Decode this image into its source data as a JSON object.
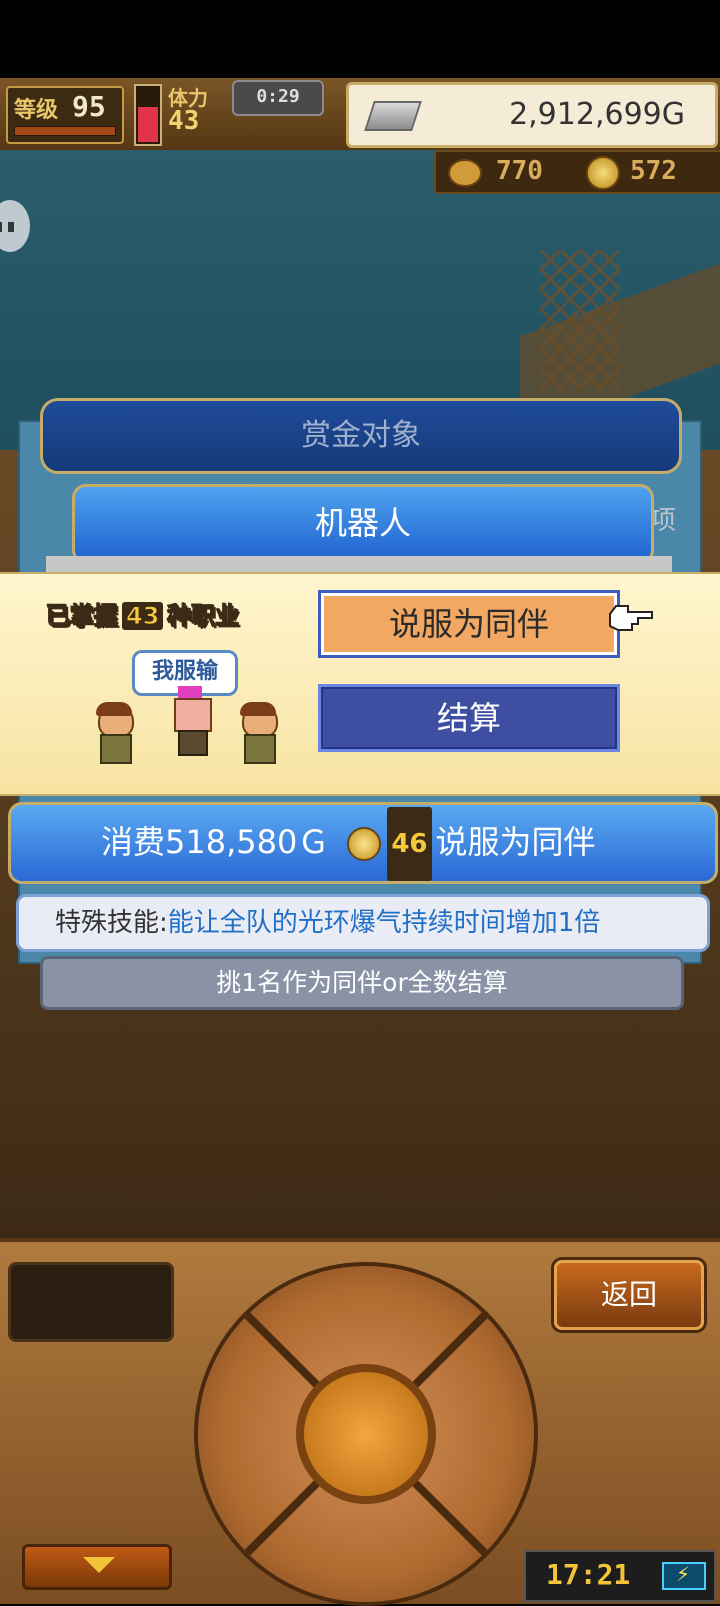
{
  "hud": {
    "level_label": "等级",
    "level_value": "95",
    "stamina_label": "体力",
    "stamina_value": "43",
    "timer": "0:29",
    "money": "2,912,699G",
    "medals": "770",
    "coins": "572"
  },
  "dialog": {
    "title": "赏金对象",
    "target_name": "机器人",
    "side_label": "项",
    "mastered_prefix": "已掌握",
    "mastered_count": "43",
    "mastered_suffix": "种职业",
    "speech": "我服输",
    "persuade_button": "说服为同伴",
    "settle_button": "结算",
    "cost_prefix": "消费518,580Ｇ",
    "cost_coins": "46",
    "cost_suffix": "说服为同伴",
    "skill_label": "特殊技能:",
    "skill_desc": "能让全队的光环爆气持续时间增加1倍",
    "hint": "挑1名作为同伴or全数结算"
  },
  "controls": {
    "back_button": "返回",
    "clock": "17:21",
    "down_icon": "triangle-down",
    "battery_icon": "battery-charging"
  },
  "colors": {
    "accent_blue": "#2a69d4",
    "persuade_orange": "#f2a862",
    "settle_navy": "#3e4fa2",
    "skill_text_blue": "#2170c6"
  }
}
